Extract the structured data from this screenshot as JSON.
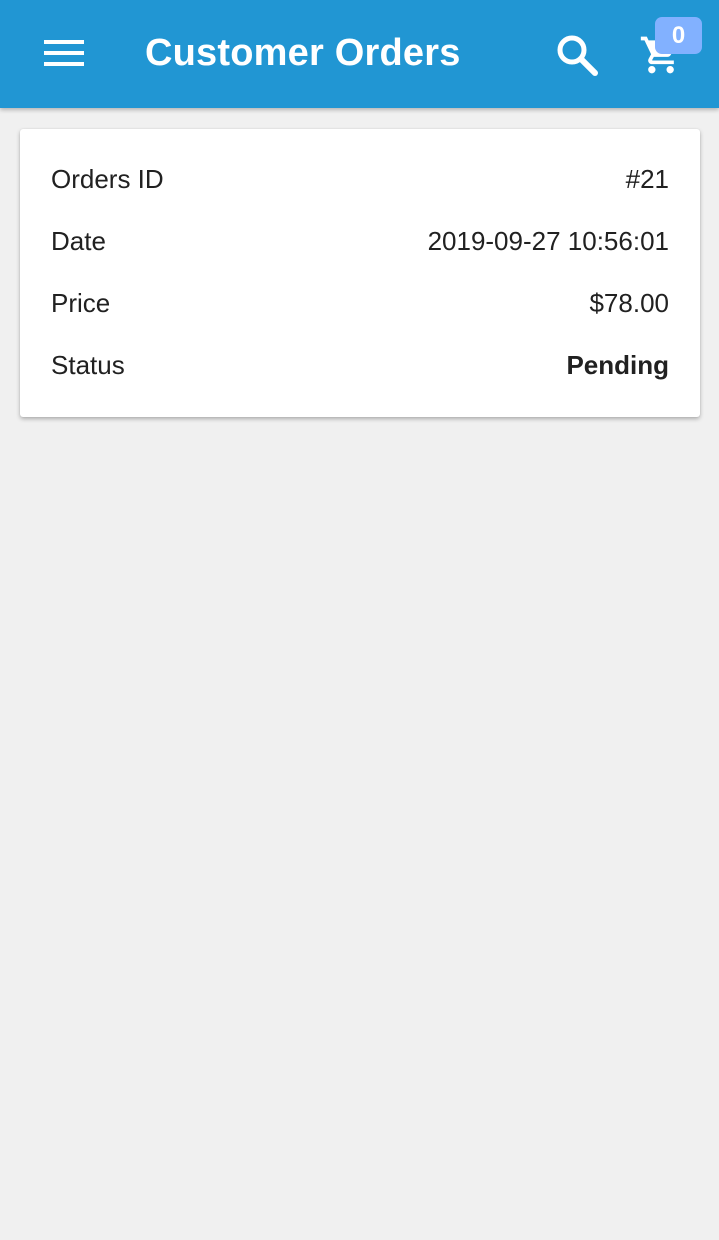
{
  "app_bar": {
    "title": "Customer Orders",
    "background_color": "#2196d3",
    "menu_icon": "hamburger-menu-icon",
    "search_icon": "search-icon",
    "cart_icon": "shopping-cart-icon",
    "cart_count": "0",
    "badge_color": "#82b1ff"
  },
  "order": {
    "rows": [
      {
        "label": "Orders ID",
        "value": "#21"
      },
      {
        "label": "Date",
        "value": "2019-09-27 10:56:01"
      },
      {
        "label": "Price",
        "value": "$78.00"
      },
      {
        "label": "Status",
        "value": "Pending"
      }
    ]
  }
}
